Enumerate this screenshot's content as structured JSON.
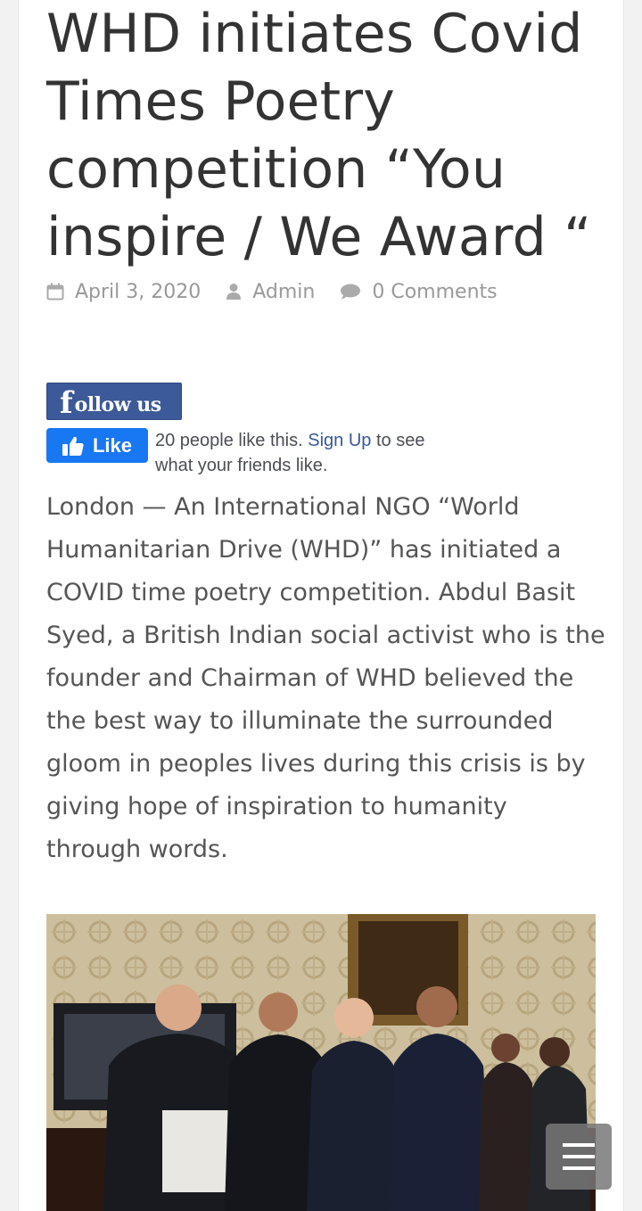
{
  "article": {
    "title": "WHD initiates Covid Times Poetry competition “You inspire / We Award “",
    "date": "April 3, 2020",
    "author": "Admin",
    "comments": "0 Comments",
    "body": "London —  An International NGO “World Humanitarian Drive (WHD)”  has initiated a COVID time poetry competition.  Abdul Basit Syed, a British Indian social activist who is the founder and Chairman of WHD believed the the best way to illuminate the surrounded gloom in peoples lives during this crisis is by giving hope of inspiration to humanity through words."
  },
  "facebook": {
    "follow_f": "f",
    "follow_text": "ollow us",
    "like_label": "Like",
    "like_count_text": "20 people like this.",
    "signup_link": "Sign Up",
    "like_suffix": "to see what your friends like."
  },
  "icons": {
    "date": "calendar-icon",
    "author": "user-icon",
    "comments": "comment-icon",
    "menu": "hamburger-menu-icon"
  },
  "colors": {
    "facebook_blue": "#1877f2",
    "follow_blue": "#3c5a99",
    "link": "#385898",
    "title": "#333333",
    "meta": "#999999",
    "body": "#555555"
  }
}
